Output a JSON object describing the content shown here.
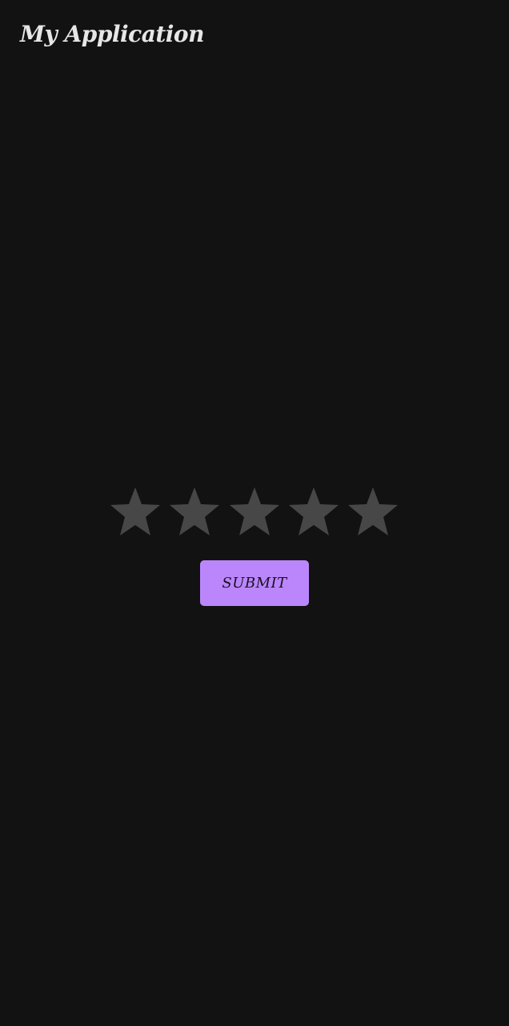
{
  "app_bar": {
    "title": "My Application"
  },
  "rating": {
    "max_stars": 5,
    "value": 0,
    "star_color_empty": "#474747",
    "star_color_filled": "#bb86fc",
    "icon": "star-icon"
  },
  "submit": {
    "label": "SUBMIT",
    "background": "#bb86fc"
  },
  "theme": {
    "background": "#121212",
    "title_color": "#e6e6e6"
  }
}
